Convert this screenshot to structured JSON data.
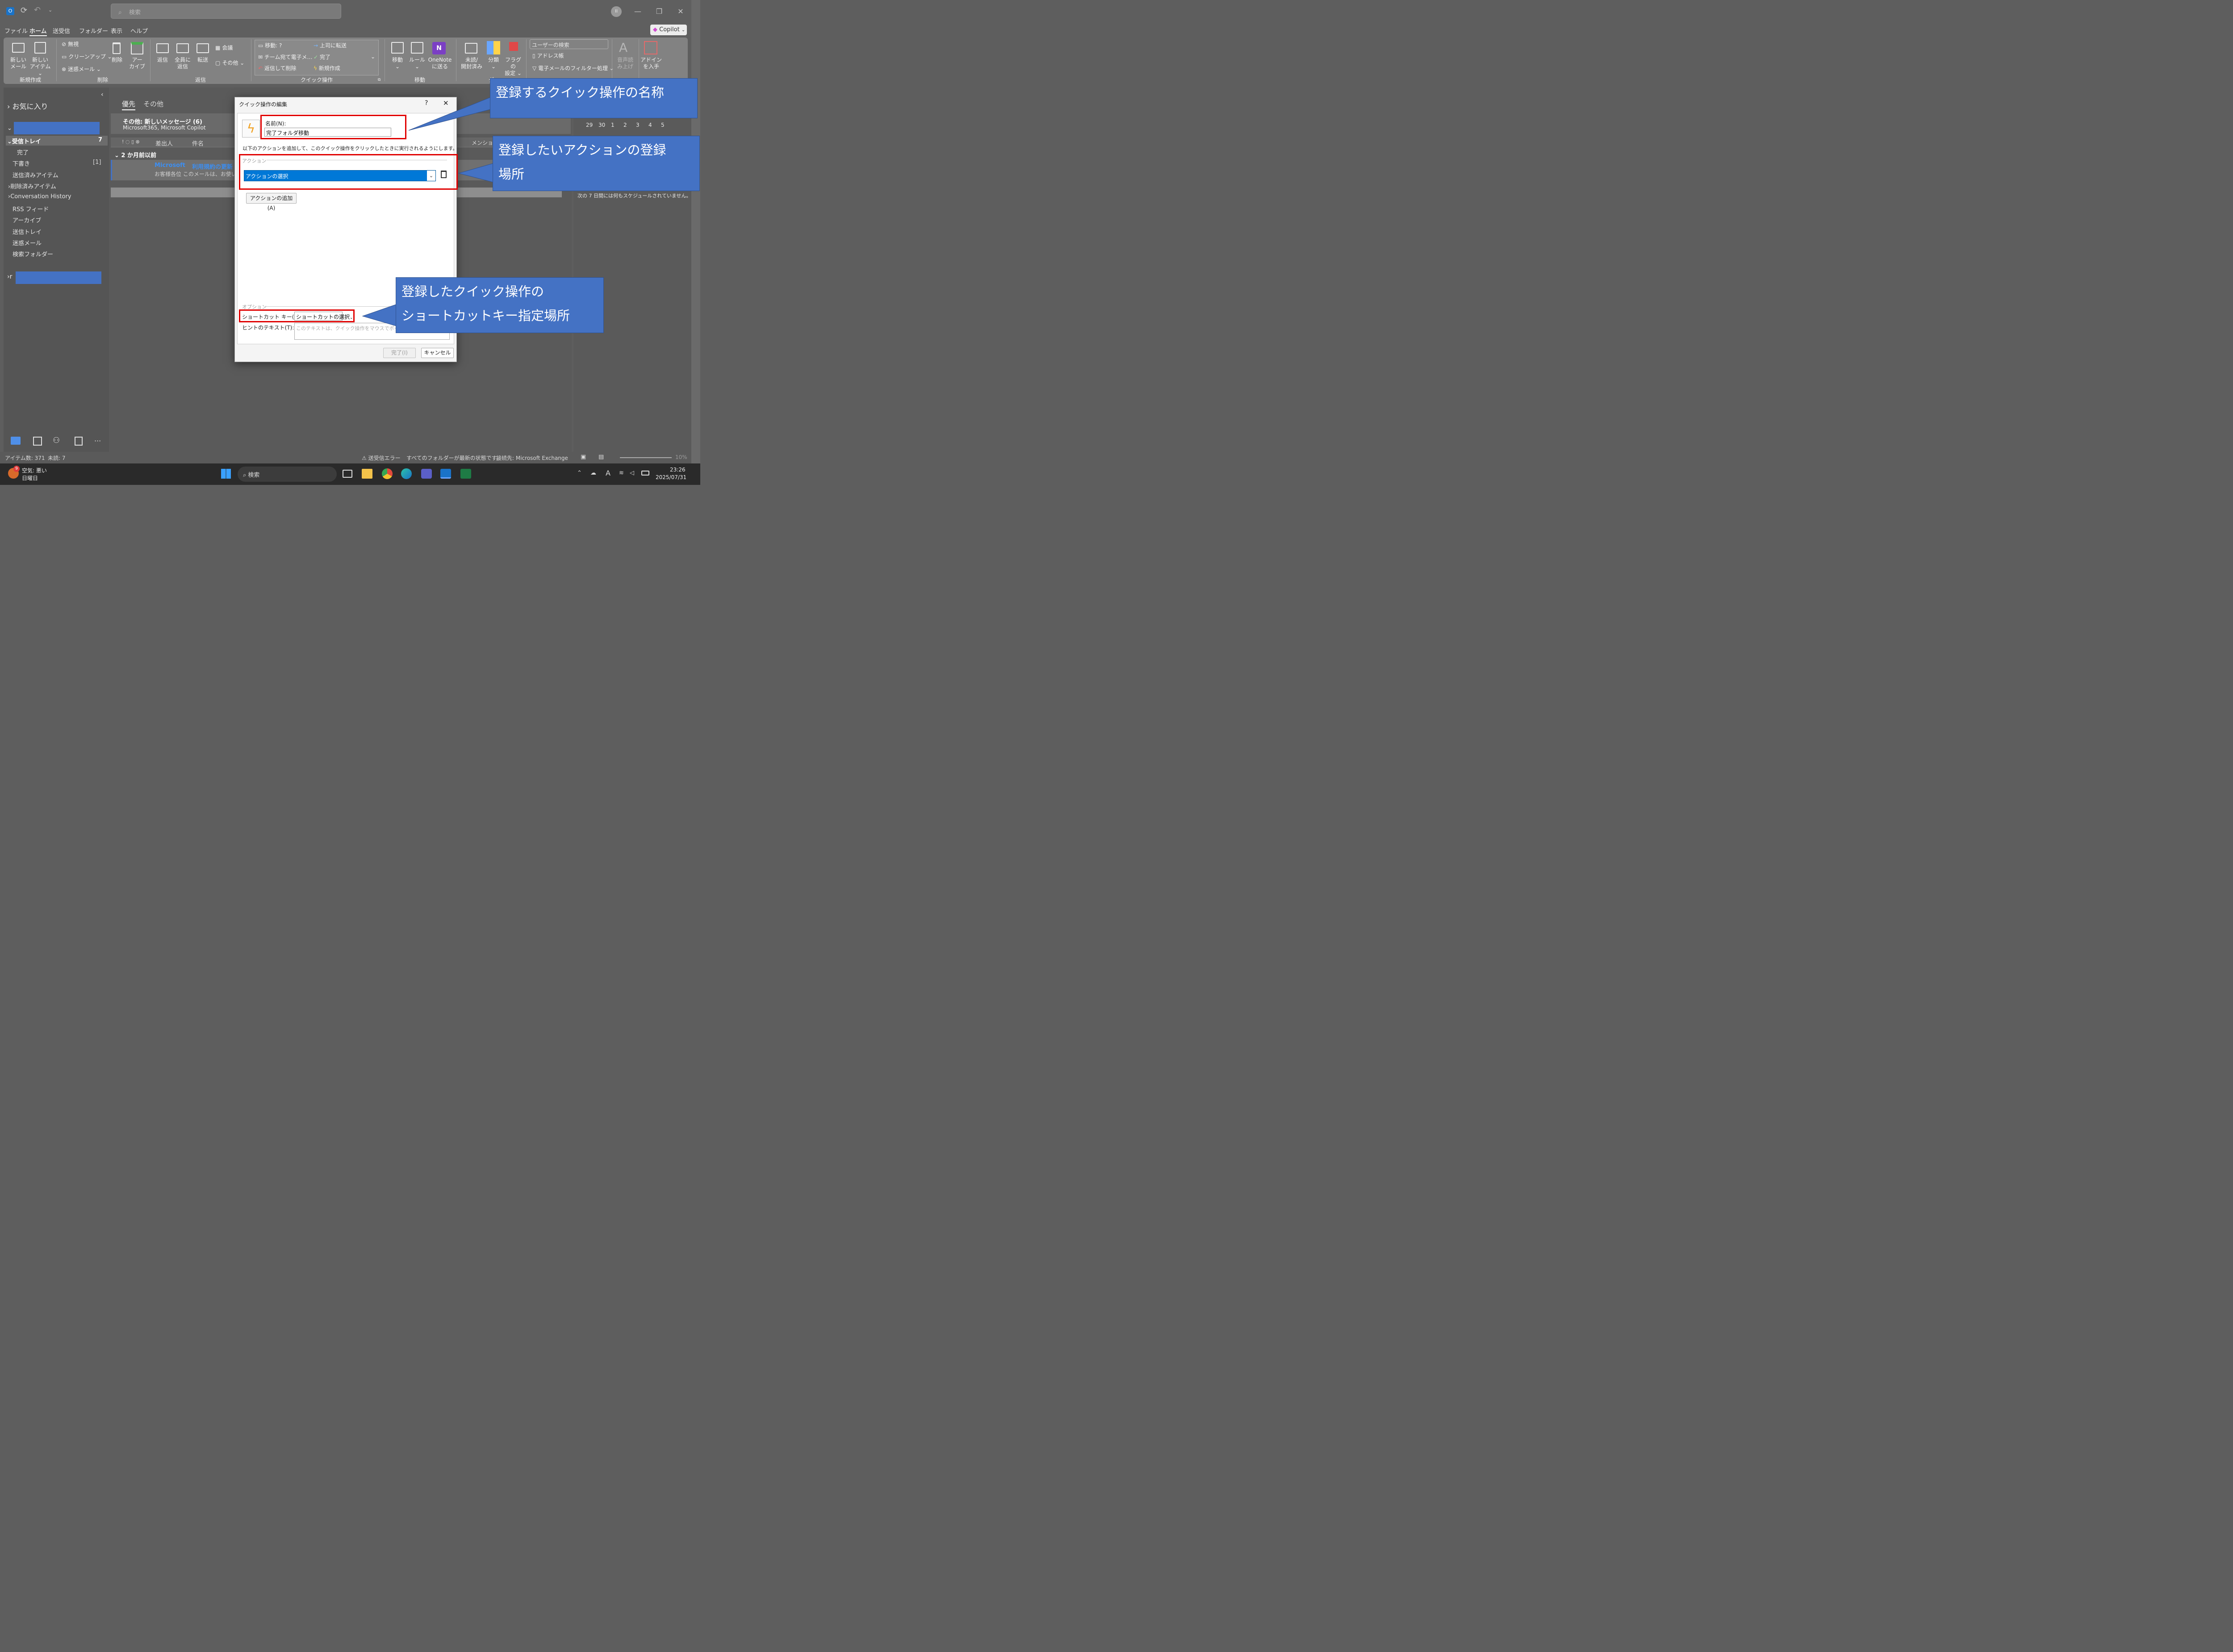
{
  "titlebar": {
    "search_placeholder": "検索",
    "user_initial": "II"
  },
  "menu": {
    "items": [
      "ファイル",
      "ホーム",
      "送受信",
      "フォルダー",
      "表示",
      "ヘルプ"
    ],
    "copilot": "Copilot"
  },
  "ribbon": {
    "new": {
      "new_mail": [
        "新しい",
        "メール"
      ],
      "new_item": [
        "新しい",
        "アイテム ⌄"
      ],
      "group": "新規作成"
    },
    "delete": {
      "ignore": "無視",
      "cleanup": "クリーンアップ ⌄",
      "junk": "迷惑メール ⌄",
      "delete": "削除",
      "archive": [
        "アー",
        "カイブ"
      ],
      "group": "削除"
    },
    "respond": {
      "reply": "返信",
      "reply_all": [
        "全員に",
        "返信"
      ],
      "forward": "転送",
      "meeting": "会議",
      "more": "その他 ⌄",
      "group": "返信"
    },
    "quick_steps": {
      "move_to": "移動: ?",
      "team_email": "チーム宛て電子メ…",
      "reply_delete": "返信して削除",
      "to_manager": "上司に転送",
      "done": "完了",
      "create_new": "新規作成",
      "group": "クイック操作"
    },
    "move": {
      "move": [
        "移動",
        "⌄"
      ],
      "rules": [
        "ルール",
        "⌄"
      ],
      "onenote": [
        "OneNote",
        "に送る"
      ],
      "group": "移動"
    },
    "tags": {
      "unread": [
        "未読/",
        "開封済み"
      ],
      "categorize": [
        "分類",
        "⌄"
      ],
      "followup": [
        "フラグの",
        "設定 ⌄"
      ],
      "group": "ダ"
    },
    "find": {
      "search_people": "ユーザーの検索",
      "address_book": "アドレス帳",
      "filter": "電子メールのフィルター処理 ⌄"
    },
    "speech": {
      "read_aloud": [
        "音声読",
        "み上げ"
      ],
      "group": "音声"
    },
    "addins": {
      "get": [
        "アドイン",
        "を入手"
      ],
      "group": "アドイン"
    }
  },
  "nav": {
    "favorites": "お気に入り",
    "inbox": "受信トレイ",
    "inbox_count": "7",
    "done": "完了",
    "drafts": "下書き",
    "drafts_count": "[1]",
    "sent": "送信済みアイテム",
    "deleted": "削除済みアイテム",
    "conversation_history": "Conversation History",
    "rss": "RSS フィード",
    "archive": "アーカイブ",
    "outbox": "送信トレイ",
    "junk": "迷惑メール",
    "search_folders": "検索フォルダー",
    "second_account_initial": "r"
  },
  "maillist": {
    "tab_focused": "優先",
    "tab_other": "その他",
    "banner_title": "その他: 新しいメッセージ (6)",
    "banner_senders": "Microsoft365, Microsoft Copilot",
    "col_from": "差出人",
    "col_subject": "件名",
    "col_mention": "メンション",
    "group_header": "2 か月前以前",
    "mail_sender": "Microsoft",
    "mail_subject": "利用規約の更新",
    "mail_preview": "お客様各位 このメールは、お使いの M"
  },
  "rightpane": {
    "calendar_row": [
      "29",
      "30",
      "1",
      "2",
      "3",
      "4",
      "5"
    ],
    "no_schedule": "次の 7 日間には何もスケジュールされていません。"
  },
  "dialog": {
    "title": "クイック操作の編集",
    "help": "?",
    "name_label": "名前(N):",
    "name_value": "完了フォルダ移動",
    "instruction": "以下のアクションを追加して、このクイック操作をクリックしたときに実行されるようにします。",
    "actions_section": "アクション",
    "action_select": "アクションの選択",
    "add_action": "アクションの追加(A)",
    "options_section": "オプション",
    "shortcut_label": "ショートカット キー(H):",
    "shortcut_value": "ショートカットの選択",
    "hint_label": "ヒントのテキスト(T):",
    "hint_placeholder": "このテキストは、クイック操作をマウスでポイントした",
    "finish": "完了(I)",
    "cancel": "キャンセル"
  },
  "callouts": {
    "name": "登録するクイック操作の名称",
    "action_line1": "登録したいアクションの登録",
    "action_line2": "場所",
    "shortcut_line1": "登録したクイック操作の",
    "shortcut_line2": "ショートカットキー指定場所"
  },
  "status": {
    "items": "アイテム数: 371",
    "unread": "未読: 7",
    "send_error": "送受信エラー",
    "folders_state": "すべてのフォルダーが最新の状態です。",
    "connection": "接続先: Microsoft Exchange",
    "zoom": "10%"
  },
  "taskbar": {
    "weather_badge": "9",
    "weather": "空気: 悪い",
    "day": "日曜日",
    "search": "検索",
    "time": "23:26",
    "date": "2025/07/31"
  }
}
